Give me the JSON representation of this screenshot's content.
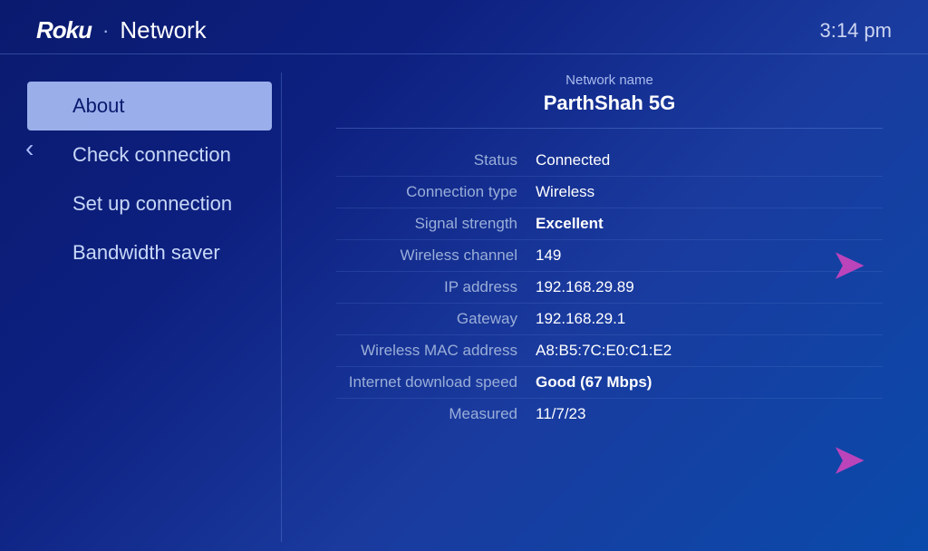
{
  "header": {
    "logo": "Roku",
    "dot": "·",
    "title": "Network",
    "time": "3:14 pm"
  },
  "sidebar": {
    "back_arrow": "‹",
    "items": [
      {
        "id": "about",
        "label": "About",
        "active": true
      },
      {
        "id": "check-connection",
        "label": "Check connection",
        "active": false
      },
      {
        "id": "set-up-connection",
        "label": "Set up connection",
        "active": false
      },
      {
        "id": "bandwidth-saver",
        "label": "Bandwidth saver",
        "active": false
      }
    ]
  },
  "detail_panel": {
    "network_name_label": "Network name",
    "network_name_value": "ParthShah 5G",
    "rows": [
      {
        "label": "Status",
        "value": "Connected"
      },
      {
        "label": "Connection type",
        "value": "Wireless"
      },
      {
        "label": "Signal strength",
        "value": "Excellent"
      },
      {
        "label": "Wireless channel",
        "value": "149"
      },
      {
        "label": "IP address",
        "value": "192.168.29.89"
      },
      {
        "label": "Gateway",
        "value": "192.168.29.1"
      },
      {
        "label": "Wireless MAC address",
        "value": "A8:B5:7C:E0:C1:E2"
      },
      {
        "label": "Internet download speed",
        "value": "Good (67 Mbps)"
      },
      {
        "label": "Measured",
        "value": "11/7/23"
      }
    ]
  },
  "arrows": [
    {
      "id": "signal-arrow",
      "unicode": "➜",
      "row": "signal-strength"
    },
    {
      "id": "measured-arrow",
      "unicode": "➜",
      "row": "measured"
    }
  ]
}
